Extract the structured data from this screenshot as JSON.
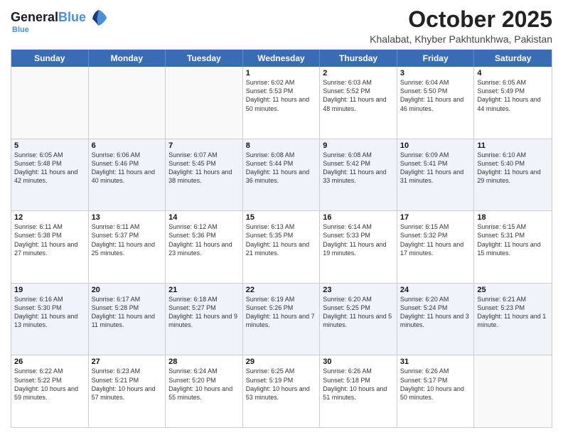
{
  "logo": {
    "line1": "General",
    "line2": "Blue"
  },
  "header": {
    "month": "October 2025",
    "location": "Khalabat, Khyber Pakhtunkhwa, Pakistan"
  },
  "days_of_week": [
    "Sunday",
    "Monday",
    "Tuesday",
    "Wednesday",
    "Thursday",
    "Friday",
    "Saturday"
  ],
  "weeks": [
    [
      {
        "day": "",
        "info": ""
      },
      {
        "day": "",
        "info": ""
      },
      {
        "day": "",
        "info": ""
      },
      {
        "day": "1",
        "info": "Sunrise: 6:02 AM\nSunset: 5:53 PM\nDaylight: 11 hours and 50 minutes."
      },
      {
        "day": "2",
        "info": "Sunrise: 6:03 AM\nSunset: 5:52 PM\nDaylight: 11 hours and 48 minutes."
      },
      {
        "day": "3",
        "info": "Sunrise: 6:04 AM\nSunset: 5:50 PM\nDaylight: 11 hours and 46 minutes."
      },
      {
        "day": "4",
        "info": "Sunrise: 6:05 AM\nSunset: 5:49 PM\nDaylight: 11 hours and 44 minutes."
      }
    ],
    [
      {
        "day": "5",
        "info": "Sunrise: 6:05 AM\nSunset: 5:48 PM\nDaylight: 11 hours and 42 minutes."
      },
      {
        "day": "6",
        "info": "Sunrise: 6:06 AM\nSunset: 5:46 PM\nDaylight: 11 hours and 40 minutes."
      },
      {
        "day": "7",
        "info": "Sunrise: 6:07 AM\nSunset: 5:45 PM\nDaylight: 11 hours and 38 minutes."
      },
      {
        "day": "8",
        "info": "Sunrise: 6:08 AM\nSunset: 5:44 PM\nDaylight: 11 hours and 36 minutes."
      },
      {
        "day": "9",
        "info": "Sunrise: 6:08 AM\nSunset: 5:42 PM\nDaylight: 11 hours and 33 minutes."
      },
      {
        "day": "10",
        "info": "Sunrise: 6:09 AM\nSunset: 5:41 PM\nDaylight: 11 hours and 31 minutes."
      },
      {
        "day": "11",
        "info": "Sunrise: 6:10 AM\nSunset: 5:40 PM\nDaylight: 11 hours and 29 minutes."
      }
    ],
    [
      {
        "day": "12",
        "info": "Sunrise: 6:11 AM\nSunset: 5:38 PM\nDaylight: 11 hours and 27 minutes."
      },
      {
        "day": "13",
        "info": "Sunrise: 6:11 AM\nSunset: 5:37 PM\nDaylight: 11 hours and 25 minutes."
      },
      {
        "day": "14",
        "info": "Sunrise: 6:12 AM\nSunset: 5:36 PM\nDaylight: 11 hours and 23 minutes."
      },
      {
        "day": "15",
        "info": "Sunrise: 6:13 AM\nSunset: 5:35 PM\nDaylight: 11 hours and 21 minutes."
      },
      {
        "day": "16",
        "info": "Sunrise: 6:14 AM\nSunset: 5:33 PM\nDaylight: 11 hours and 19 minutes."
      },
      {
        "day": "17",
        "info": "Sunrise: 6:15 AM\nSunset: 5:32 PM\nDaylight: 11 hours and 17 minutes."
      },
      {
        "day": "18",
        "info": "Sunrise: 6:15 AM\nSunset: 5:31 PM\nDaylight: 11 hours and 15 minutes."
      }
    ],
    [
      {
        "day": "19",
        "info": "Sunrise: 6:16 AM\nSunset: 5:30 PM\nDaylight: 11 hours and 13 minutes."
      },
      {
        "day": "20",
        "info": "Sunrise: 6:17 AM\nSunset: 5:28 PM\nDaylight: 11 hours and 11 minutes."
      },
      {
        "day": "21",
        "info": "Sunrise: 6:18 AM\nSunset: 5:27 PM\nDaylight: 11 hours and 9 minutes."
      },
      {
        "day": "22",
        "info": "Sunrise: 6:19 AM\nSunset: 5:26 PM\nDaylight: 11 hours and 7 minutes."
      },
      {
        "day": "23",
        "info": "Sunrise: 6:20 AM\nSunset: 5:25 PM\nDaylight: 11 hours and 5 minutes."
      },
      {
        "day": "24",
        "info": "Sunrise: 6:20 AM\nSunset: 5:24 PM\nDaylight: 11 hours and 3 minutes."
      },
      {
        "day": "25",
        "info": "Sunrise: 6:21 AM\nSunset: 5:23 PM\nDaylight: 11 hours and 1 minute."
      }
    ],
    [
      {
        "day": "26",
        "info": "Sunrise: 6:22 AM\nSunset: 5:22 PM\nDaylight: 10 hours and 59 minutes."
      },
      {
        "day": "27",
        "info": "Sunrise: 6:23 AM\nSunset: 5:21 PM\nDaylight: 10 hours and 57 minutes."
      },
      {
        "day": "28",
        "info": "Sunrise: 6:24 AM\nSunset: 5:20 PM\nDaylight: 10 hours and 55 minutes."
      },
      {
        "day": "29",
        "info": "Sunrise: 6:25 AM\nSunset: 5:19 PM\nDaylight: 10 hours and 53 minutes."
      },
      {
        "day": "30",
        "info": "Sunrise: 6:26 AM\nSunset: 5:18 PM\nDaylight: 10 hours and 51 minutes."
      },
      {
        "day": "31",
        "info": "Sunrise: 6:26 AM\nSunset: 5:17 PM\nDaylight: 10 hours and 50 minutes."
      },
      {
        "day": "",
        "info": ""
      }
    ]
  ]
}
